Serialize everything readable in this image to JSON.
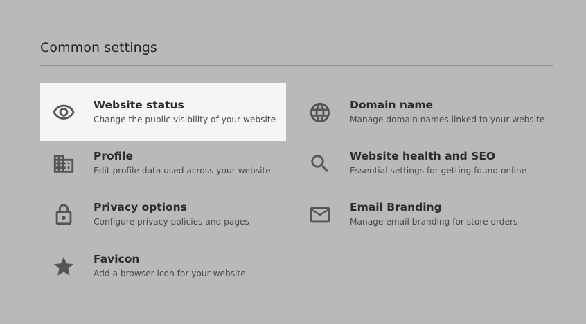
{
  "section": {
    "title": "Common settings"
  },
  "items": [
    {
      "id": "website-status",
      "title": "Website status",
      "description": "Change the public visibility of your website",
      "icon": "eye-icon",
      "active": true
    },
    {
      "id": "domain-name",
      "title": "Domain name",
      "description": "Manage domain names linked to your website",
      "icon": "globe-icon",
      "active": false
    },
    {
      "id": "profile",
      "title": "Profile",
      "description": "Edit profile data used across your website",
      "icon": "building-icon",
      "active": false
    },
    {
      "id": "website-health-seo",
      "title": "Website health and SEO",
      "description": "Essential settings for getting found online",
      "icon": "search-icon",
      "active": false
    },
    {
      "id": "privacy-options",
      "title": "Privacy options",
      "description": "Configure privacy policies and pages",
      "icon": "lock-icon",
      "active": false
    },
    {
      "id": "email-branding",
      "title": "Email Branding",
      "description": "Manage email branding for store orders",
      "icon": "mail-icon",
      "active": false
    },
    {
      "id": "favicon",
      "title": "Favicon",
      "description": "Add a browser icon for your website",
      "icon": "star-icon",
      "active": false
    }
  ],
  "colors": {
    "background": "#b9b9b9",
    "active_item": "#f5f5f5",
    "icon": "#555555",
    "divider": "#8f8f8f"
  }
}
